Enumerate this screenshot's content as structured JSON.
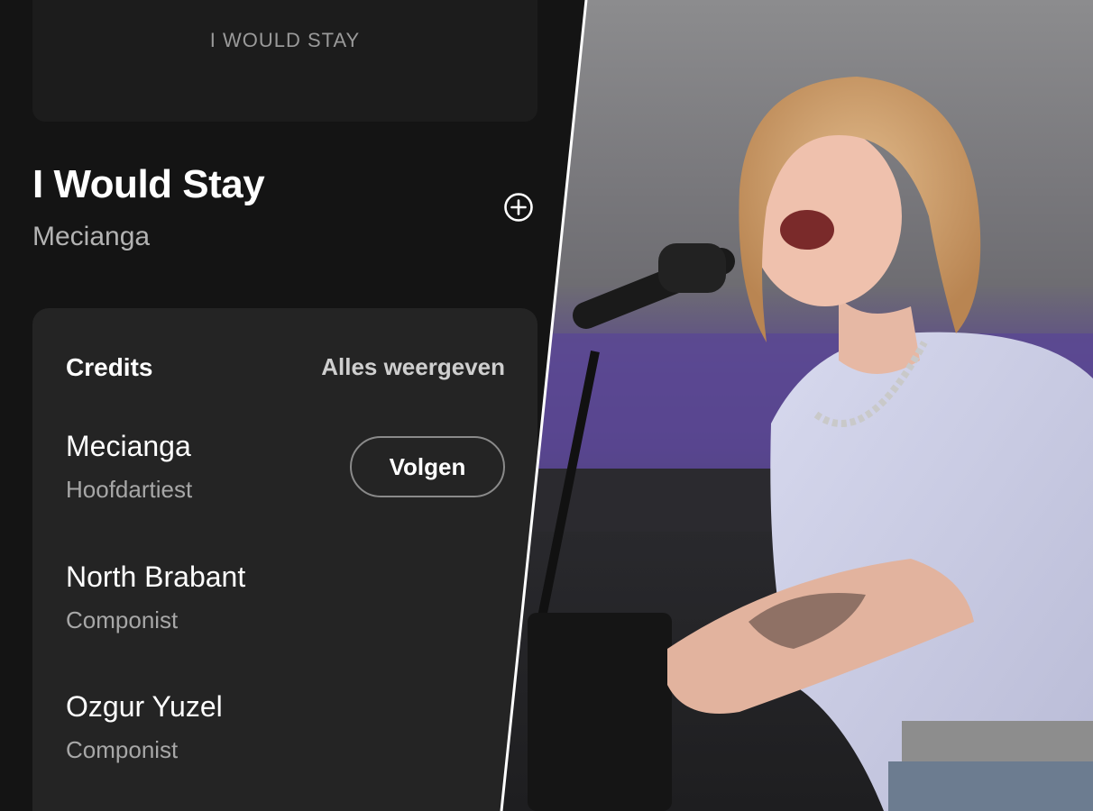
{
  "cover": {
    "caption": "I WOULD STAY"
  },
  "track": {
    "title": "I Would Stay",
    "artist": "Mecianga"
  },
  "actions": {
    "add_icon": "plus-circle-icon"
  },
  "credits": {
    "title": "Credits",
    "show_all": "Alles weergeven",
    "follow_label": "Volgen",
    "items": [
      {
        "name": "Mecianga",
        "role": "Hoofdartiest"
      },
      {
        "name": "North Brabant",
        "role": "Componist"
      },
      {
        "name": "Ozgur Yuzel",
        "role": "Componist"
      }
    ]
  },
  "colors": {
    "background": "#141414",
    "card": "#242424",
    "text": "#ffffff",
    "muted": "#b3b3b3"
  }
}
